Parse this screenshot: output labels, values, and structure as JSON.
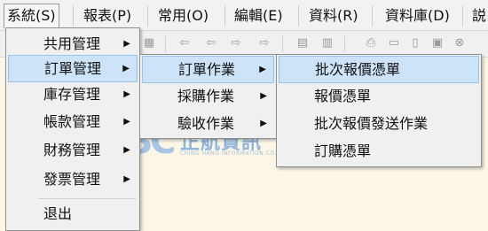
{
  "menubar": {
    "items": [
      {
        "label": "系統(S)"
      },
      {
        "label": "報表(P)"
      },
      {
        "label": "常用(O)"
      },
      {
        "label": "編輯(E)"
      },
      {
        "label": "資料(R)"
      },
      {
        "label": "資料庫(D)"
      },
      {
        "label": "説"
      }
    ]
  },
  "toolbar": {
    "icons": [
      "table-icon",
      "first-record-icon",
      "previous-record-icon",
      "next-record-icon",
      "last-record-icon",
      "calculator-icon",
      "export-icon",
      "print-icon",
      "new-document-icon",
      "copy-document-icon",
      "save-icon",
      "cancel-icon"
    ]
  },
  "system_menu": {
    "items": [
      {
        "label": "共用管理",
        "has_submenu": true
      },
      {
        "label": "訂單管理",
        "has_submenu": true
      },
      {
        "label": "庫存管理",
        "has_submenu": true
      },
      {
        "label": "帳款管理",
        "has_submenu": true
      },
      {
        "label": "財務管理",
        "has_submenu": true
      },
      {
        "label": "發票管理",
        "has_submenu": true
      },
      {
        "label": "退出",
        "has_submenu": false
      }
    ]
  },
  "order_menu": {
    "items": [
      {
        "label": "訂單作業",
        "has_submenu": true
      },
      {
        "label": "採購作業",
        "has_submenu": true
      },
      {
        "label": "驗收作業",
        "has_submenu": true
      }
    ]
  },
  "order_ops_menu": {
    "items": [
      {
        "label": "批次報價憑單"
      },
      {
        "label": "報價憑單"
      },
      {
        "label": "批次報價發送作業"
      },
      {
        "label": "訂購憑單"
      }
    ]
  },
  "watermark": {
    "mark": "3C",
    "name": "正航資訊",
    "english": "CHING HANG INFORMATION CO., LTD."
  },
  "colors": {
    "highlight_bg": "#cde3f7",
    "highlight_border": "#9bc3ea",
    "menu_bg": "#f0f0f0",
    "workspace_bg": "#fbf6e6"
  }
}
